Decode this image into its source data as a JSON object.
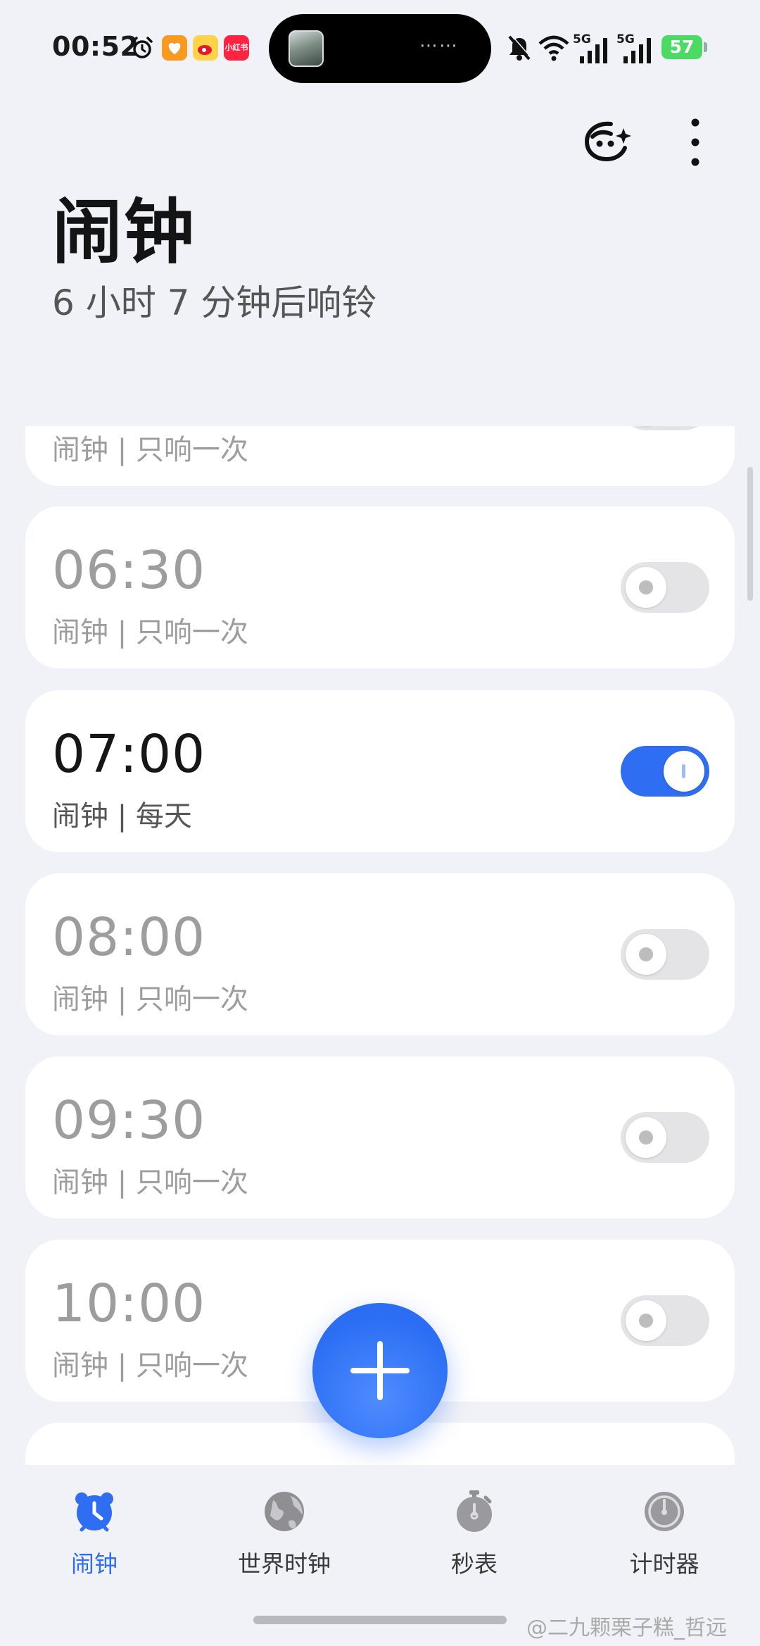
{
  "status_bar": {
    "time": "00:52",
    "app_badge": "小红书",
    "network_1": "5G",
    "network_2": "5G",
    "battery": "57"
  },
  "header": {
    "title": "闹钟",
    "subtitle": "6 小时 7 分钟后响铃"
  },
  "alarms": [
    {
      "time": "",
      "label": "闹钟 | 只响一次",
      "enabled": false
    },
    {
      "time": "06:30",
      "label": "闹钟 | 只响一次",
      "enabled": false
    },
    {
      "time": "07:00",
      "label": "闹钟 | 每天",
      "enabled": true
    },
    {
      "time": "08:00",
      "label": "闹钟 | 只响一次",
      "enabled": false
    },
    {
      "time": "09:30",
      "label": "闹钟 | 只响一次",
      "enabled": false
    },
    {
      "time": "10:00",
      "label": "闹钟 | 只响一次",
      "enabled": false
    }
  ],
  "bottom_nav": {
    "items": [
      {
        "label": "闹钟",
        "icon": "alarm-clock-icon",
        "active": true
      },
      {
        "label": "世界时钟",
        "icon": "globe-icon",
        "active": false
      },
      {
        "label": "秒表",
        "icon": "stopwatch-icon",
        "active": false
      },
      {
        "label": "计时器",
        "icon": "timer-icon",
        "active": false
      }
    ]
  },
  "watermark": "@二九颗栗子糕_哲远",
  "colors": {
    "accent": "#2f6ef2",
    "background": "#f1f2f7",
    "card": "#ffffff",
    "inactive_text": "#9d9d9d"
  }
}
